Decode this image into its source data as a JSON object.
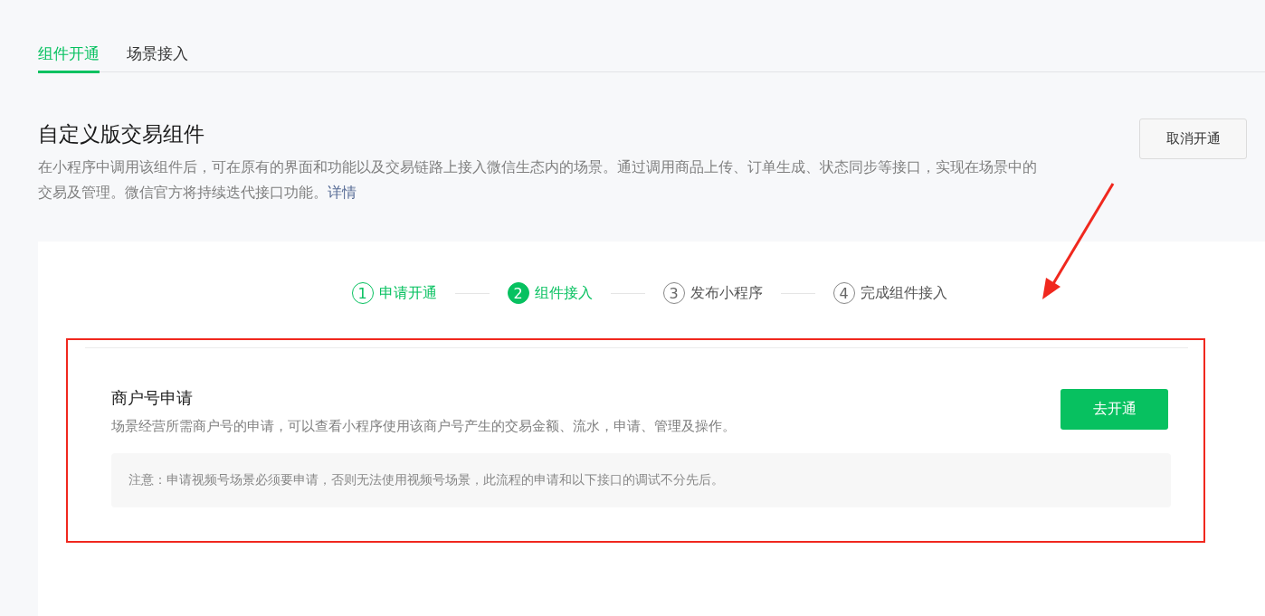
{
  "tabs": [
    {
      "label": "组件开通",
      "selected": true
    },
    {
      "label": "场景接入",
      "selected": false
    }
  ],
  "section": {
    "title": "自定义版交易组件",
    "description": "在小程序中调用该组件后，可在原有的界面和功能以及交易链路上接入微信生态内的场景。通过调用商品上传、订单生成、状态同步等接口，实现在场景中的交易及管理。微信官方将持续迭代接口功能。",
    "link": "详情",
    "button": "取消开通"
  },
  "steps": [
    {
      "number": "1",
      "label": "申请开通",
      "completed": true,
      "selected": false
    },
    {
      "number": "2",
      "label": "组件接入",
      "completed": false,
      "selected": true
    },
    {
      "number": "3",
      "label": "发布小程序",
      "completed": false,
      "selected": false
    },
    {
      "number": "4",
      "label": "完成组件接入",
      "completed": false,
      "selected": false
    }
  ],
  "merchant": {
    "title": "商户号申请",
    "description": "场景经营所需商户号的申请，可以查看小程序使用该商户号产生的交易金额、流水，申请、管理及操作。",
    "button": "去开通",
    "notice": "注意：申请视频号场景必须要申请，否则无法使用视频号场景，此流程的申请和以下接口的调试不分先后。"
  }
}
